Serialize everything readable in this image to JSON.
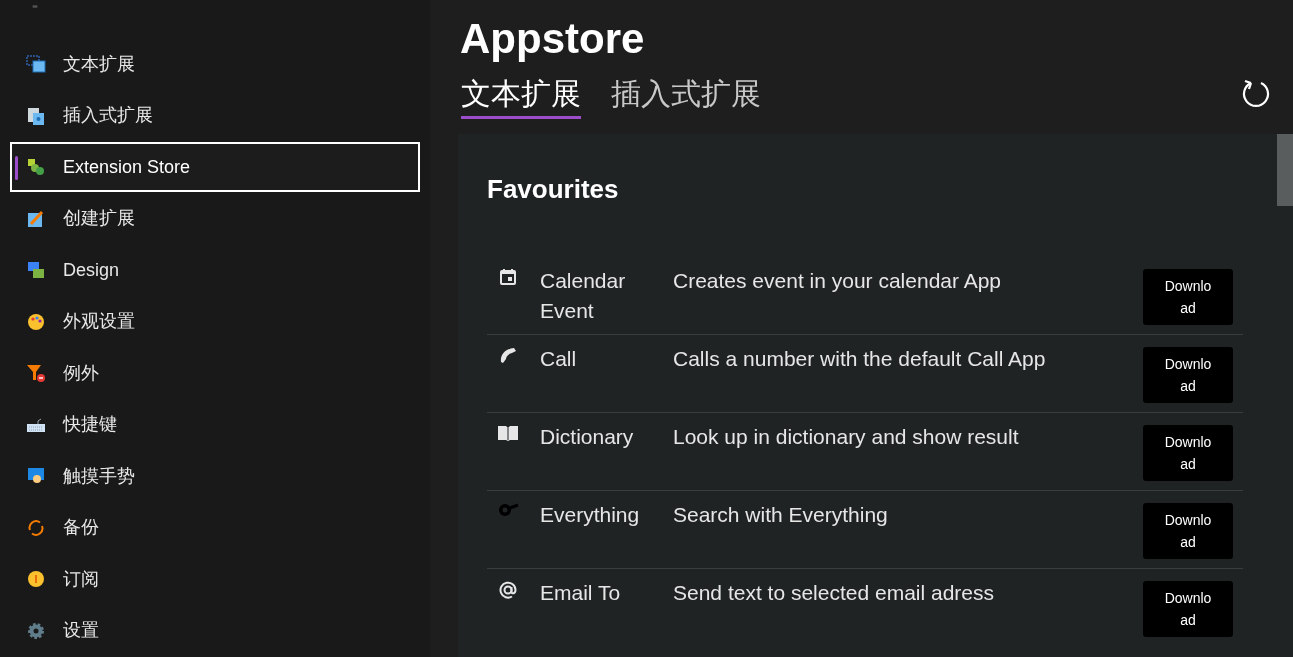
{
  "sidebar": {
    "items": [
      {
        "label": "文本扩展",
        "selected": false
      },
      {
        "label": "插入式扩展",
        "selected": false
      },
      {
        "label": "Extension Store",
        "selected": true
      },
      {
        "label": "创建扩展",
        "selected": false
      },
      {
        "label": "Design",
        "selected": false
      },
      {
        "label": "外观设置",
        "selected": false
      },
      {
        "label": "例外",
        "selected": false
      },
      {
        "label": "快捷键",
        "selected": false
      },
      {
        "label": "触摸手势",
        "selected": false
      },
      {
        "label": "备份",
        "selected": false
      },
      {
        "label": "订阅",
        "selected": false
      },
      {
        "label": "设置",
        "selected": false
      }
    ]
  },
  "title": "Appstore",
  "tabs": [
    {
      "label": "文本扩展",
      "selected": true
    },
    {
      "label": "插入式扩展",
      "selected": false
    }
  ],
  "section_title": "Favourites",
  "extensions": [
    {
      "name": "Calendar Event",
      "description": "Creates event in your calendar App",
      "button": "Download"
    },
    {
      "name": "Call",
      "description": "Calls a number with the default Call App",
      "button": "Download"
    },
    {
      "name": "Dictionary",
      "description": "Look up in dictionary and show result",
      "button": "Download"
    },
    {
      "name": "Everything",
      "description": "Search with Everything",
      "button": "Download"
    },
    {
      "name": "Email To",
      "description": "Send text to selected email adress",
      "button": "Download"
    }
  ]
}
